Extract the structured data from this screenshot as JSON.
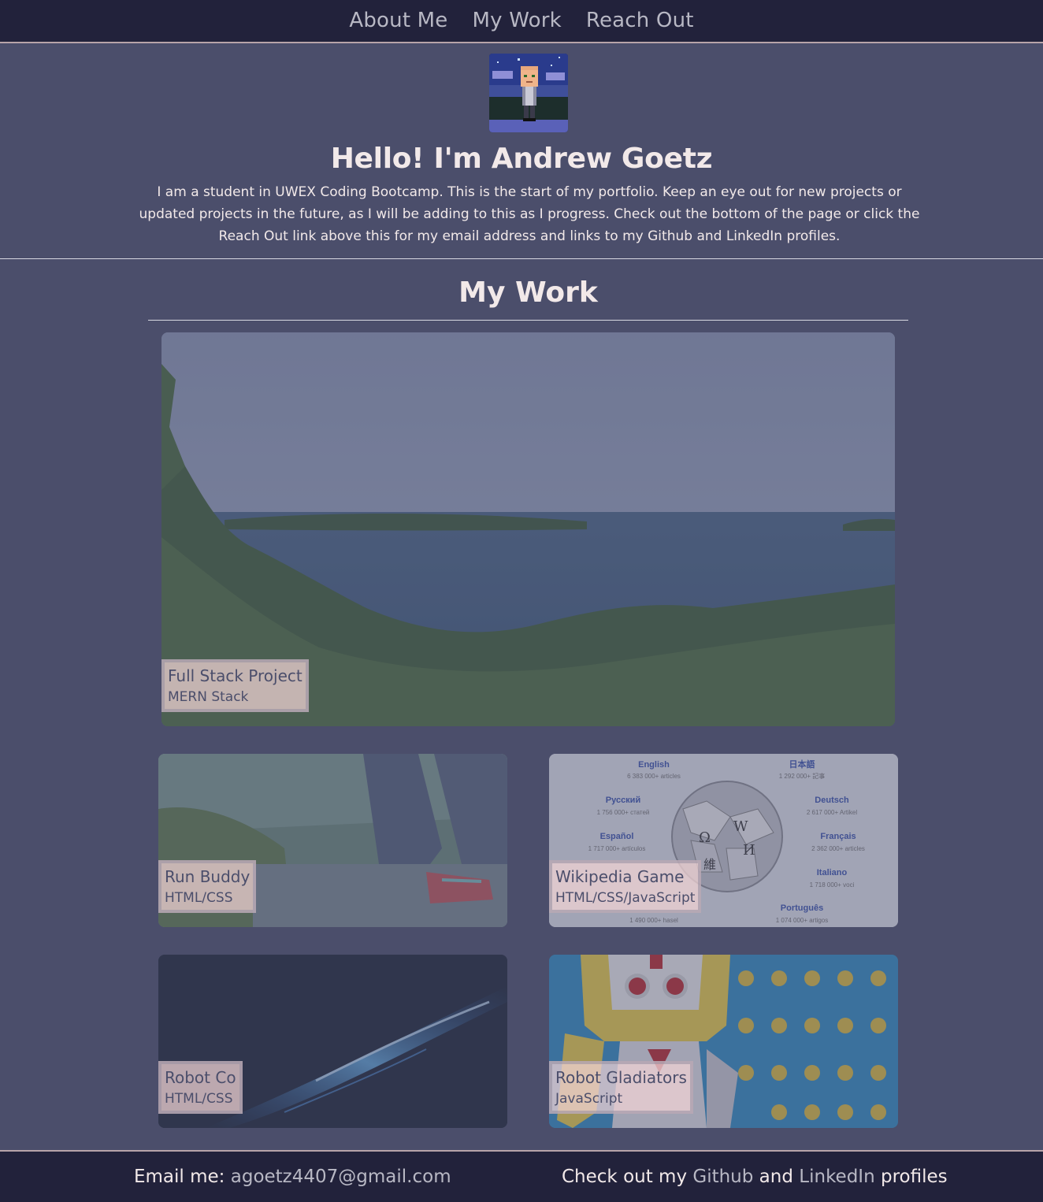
{
  "nav": {
    "items": [
      {
        "label": "About Me"
      },
      {
        "label": "My Work"
      },
      {
        "label": "Reach Out"
      }
    ]
  },
  "hero": {
    "title": "Hello! I'm Andrew Goetz",
    "bio": "I am a student in UWEX Coding Bootcamp. This is the start of my portfolio. Keep an eye out for new projects or updated projects in the future, as I will be adding to this as I progress. Check out the bottom of the page or click the Reach Out link above this for my email address and links to my Github and LinkedIn profiles."
  },
  "work": {
    "title": "My Work",
    "projects": [
      {
        "name": "Full Stack Project",
        "tech": "MERN Stack",
        "image": "lakeshore-forest-photo"
      },
      {
        "name": "Run Buddy",
        "tech": "HTML/CSS",
        "image": "running-shoe-photo"
      },
      {
        "name": "Wikipedia Game",
        "tech": "HTML/CSS/JavaScript",
        "image": "wikipedia-globe-image"
      },
      {
        "name": "Robot Co",
        "tech": "HTML/CSS",
        "image": "dark-light-streak-image"
      },
      {
        "name": "Robot Gladiators",
        "tech": "JavaScript",
        "image": "robot-cartoon-image"
      }
    ]
  },
  "wiki_image": {
    "languages": [
      {
        "name": "English",
        "count": "6 383 000+ articles"
      },
      {
        "name": "日本語",
        "count": "1 292 000+ 記事"
      },
      {
        "name": "Русский",
        "count": "1 756 000+ статей"
      },
      {
        "name": "Deutsch",
        "count": "2 617 000+ Artikel"
      },
      {
        "name": "Español",
        "count": "1 717 000+ artículos"
      },
      {
        "name": "Français",
        "count": "2 362 000+ articles"
      },
      {
        "name": "Italiano",
        "count": "1 718 000+ voci"
      },
      {
        "name": "Português",
        "count": "1 074 000+ artigos"
      },
      {
        "name": "",
        "count": "1 490 000+ hasel"
      }
    ]
  },
  "footer": {
    "email_prefix": "Email me: ",
    "email": "agoetz4407@gmail.com",
    "social_prefix": "Check out my ",
    "github": "Github",
    "and": " and ",
    "linkedin": "LinkedIn",
    "social_suffix": " profiles"
  },
  "colors": {
    "background": "#4b4e6b",
    "nav_bg": "#22223b",
    "text": "#f2e9e9",
    "link": "#b8b8c4",
    "label_bg": "#f2d4d5"
  }
}
